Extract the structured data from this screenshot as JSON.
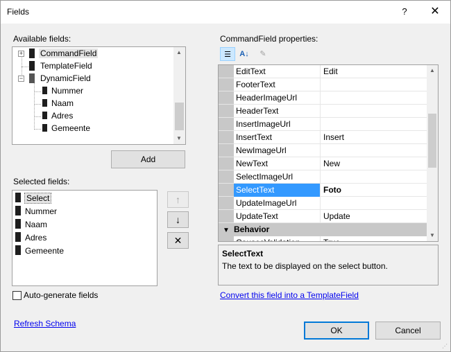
{
  "window": {
    "title": "Fields",
    "help_label": "?",
    "close_label": "✕"
  },
  "available": {
    "label": "Available fields:",
    "items": [
      {
        "label": "CommandField"
      },
      {
        "label": "TemplateField"
      },
      {
        "label": "DynamicField"
      },
      {
        "label": "Nummer"
      },
      {
        "label": "Naam"
      },
      {
        "label": "Adres"
      },
      {
        "label": "Gemeente"
      }
    ],
    "add_label": "Add"
  },
  "selected": {
    "label": "Selected fields:",
    "items": [
      {
        "label": "Select"
      },
      {
        "label": "Nummer"
      },
      {
        "label": "Naam"
      },
      {
        "label": "Adres"
      },
      {
        "label": "Gemeente"
      }
    ],
    "move_up_label": "↑",
    "move_down_label": "↓",
    "delete_label": "✕"
  },
  "autogen": {
    "label": "Auto-generate fields",
    "checked": false
  },
  "refresh_label": "Refresh Schema",
  "properties": {
    "label": "CommandField properties:",
    "rows": [
      {
        "name": "EditText",
        "value": "Edit"
      },
      {
        "name": "FooterText",
        "value": ""
      },
      {
        "name": "HeaderImageUrl",
        "value": ""
      },
      {
        "name": "HeaderText",
        "value": ""
      },
      {
        "name": "InsertImageUrl",
        "value": ""
      },
      {
        "name": "InsertText",
        "value": "Insert"
      },
      {
        "name": "NewImageUrl",
        "value": ""
      },
      {
        "name": "NewText",
        "value": "New"
      },
      {
        "name": "SelectImageUrl",
        "value": ""
      },
      {
        "name": "SelectText",
        "value": "Foto"
      },
      {
        "name": "UpdateImageUrl",
        "value": ""
      },
      {
        "name": "UpdateText",
        "value": "Update"
      }
    ],
    "category": "Behavior",
    "partial_row": {
      "name": "CausesValidation",
      "value": "True"
    },
    "selected_name": "SelectText",
    "description_title": "SelectText",
    "description_text": "The text to be displayed on the select button."
  },
  "convert_link": "Convert this field into a TemplateField",
  "ok_label": "OK",
  "cancel_label": "Cancel",
  "colors": {
    "accent": "#0078d7",
    "selection": "#3399ff",
    "link": "#0000ee"
  }
}
